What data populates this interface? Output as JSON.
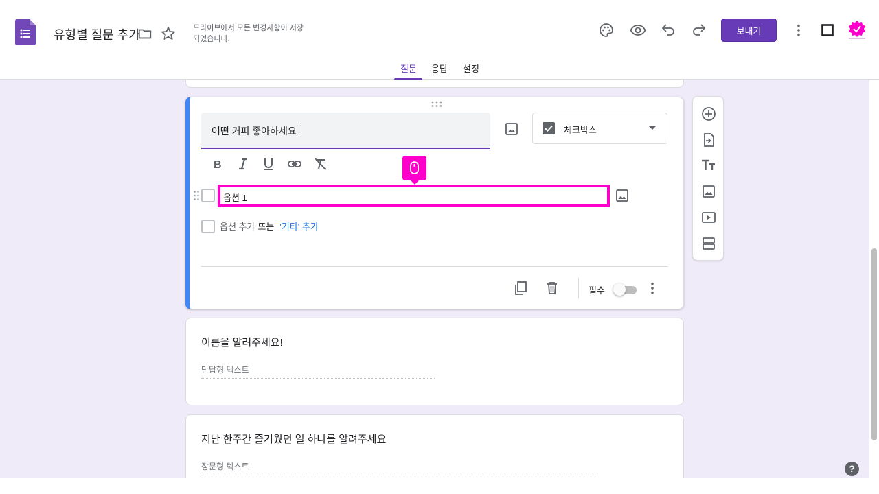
{
  "header": {
    "doc_title": "유형별 질문 추가",
    "save_status": "드라이브에서 모든 변경사항이 저장되었습니다.",
    "send_label": "보내기",
    "brand_color": "#673ab7",
    "icons": [
      "palette-icon",
      "preview-eye-icon",
      "undo-icon",
      "redo-icon",
      "more-vert-icon",
      "square-icon"
    ]
  },
  "tabs": [
    {
      "label": "질문",
      "active": true
    },
    {
      "label": "응답",
      "active": false
    },
    {
      "label": "설정",
      "active": false
    }
  ],
  "active_question": {
    "title": "어떤 커피 좋아하세요",
    "type_label": "체크박스",
    "options": [
      {
        "label": "옵션 1"
      }
    ],
    "add_option": "옵션 추가",
    "or_label": "또는",
    "add_other": "'기타' 추가",
    "required_label": "필수",
    "required": false,
    "accent_color": "#4285f4",
    "highlight_color": "#ff00cc"
  },
  "questions": [
    {
      "title": "이름을 알려주세요!",
      "answer_placeholder": "단답형 텍스트"
    },
    {
      "title": "지난 한주간 즐거웠던 일 하나를 알려주세요",
      "answer_placeholder": "장문형 텍스트"
    }
  ],
  "side_toolbar": [
    "add-question-icon",
    "import-questions-icon",
    "add-title-icon",
    "add-image-icon",
    "add-video-icon",
    "add-section-icon"
  ],
  "help": {
    "label": "?"
  }
}
